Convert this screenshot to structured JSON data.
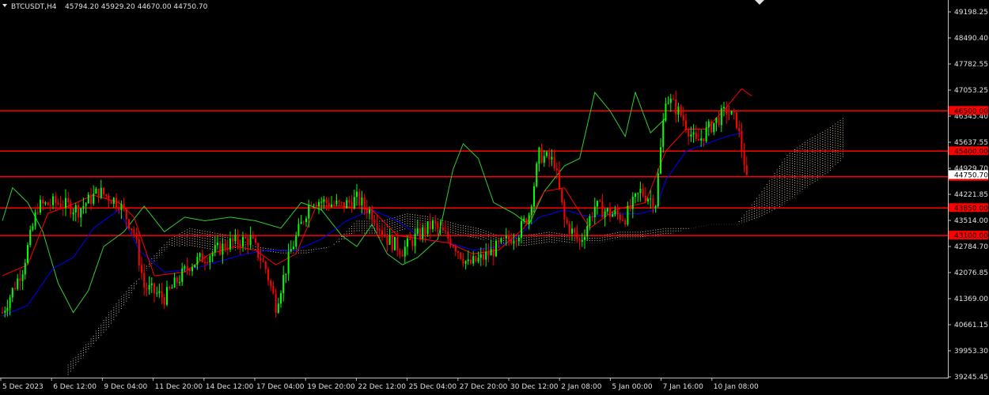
{
  "header": {
    "symbol": "BTCUSDT,H4",
    "ohlc": "45794.20 45929.20 44670.00 44750.70"
  },
  "colors": {
    "background": "#000000",
    "bull": "#00ff00",
    "bear": "#ff0000",
    "tenkan": "#ff0000",
    "kijun": "#0000ff",
    "chikou": "#32cd32",
    "cloud_a": "#ffe4c4",
    "cloud_b": "#e8e8e8",
    "level": "#ff0000",
    "axis": "#c0c0c0"
  },
  "chart_data": {
    "type": "candlestick",
    "ylim": [
      39245.45,
      49400
    ],
    "y_ticks": [
      "49198.25",
      "48490.40",
      "47782.55",
      "47053.25",
      "46345.40",
      "45637.55",
      "44929.70",
      "44221.85",
      "43514.00",
      "42784.70",
      "42076.85",
      "41369.00",
      "40661.15",
      "39953.30",
      "39245.45"
    ],
    "x_ticks": [
      "5 Dec 2023",
      "6 Dec 12:00",
      "9 Dec 04:00",
      "11 Dec 20:00",
      "14 Dec 12:00",
      "17 Dec 04:00",
      "19 Dec 20:00",
      "22 Dec 12:00",
      "25 Dec 04:00",
      "27 Dec 20:00",
      "30 Dec 12:00",
      "2 Jan 08:00",
      "5 Jan 00:00",
      "7 Jan 16:00",
      "10 Jan 08:00"
    ],
    "levels": [
      {
        "value": 46500,
        "label": "46500.00"
      },
      {
        "value": 45400,
        "label": "45400.00"
      },
      {
        "value": 44700,
        "label": "44700.00"
      },
      {
        "value": 43850,
        "label": "43850.00"
      },
      {
        "value": 43100,
        "label": "43100.00"
      }
    ],
    "current_price": {
      "value": 44750.7,
      "label": "44750.70"
    },
    "x_start": "5 Dec 2023 00:00",
    "bar_period_hours": 4,
    "anchors": [
      [
        0,
        41000
      ],
      [
        8,
        42200
      ],
      [
        14,
        43900
      ],
      [
        22,
        44000
      ],
      [
        30,
        43800
      ],
      [
        38,
        44300
      ],
      [
        46,
        44000
      ],
      [
        52,
        43200
      ],
      [
        56,
        41700
      ],
      [
        64,
        41400
      ],
      [
        74,
        42300
      ],
      [
        82,
        42600
      ],
      [
        90,
        42900
      ],
      [
        98,
        43000
      ],
      [
        104,
        42200
      ],
      [
        108,
        41200
      ],
      [
        114,
        42700
      ],
      [
        122,
        44100
      ],
      [
        128,
        44000
      ],
      [
        134,
        43900
      ],
      [
        140,
        44100
      ],
      [
        146,
        43700
      ],
      [
        152,
        43000
      ],
      [
        158,
        42700
      ],
      [
        164,
        43100
      ],
      [
        170,
        43400
      ],
      [
        178,
        42900
      ],
      [
        184,
        42300
      ],
      [
        190,
        42500
      ],
      [
        196,
        42800
      ],
      [
        204,
        43200
      ],
      [
        208,
        43700
      ],
      [
        212,
        45300
      ],
      [
        218,
        45100
      ],
      [
        222,
        43500
      ],
      [
        228,
        42900
      ],
      [
        234,
        43900
      ],
      [
        240,
        43700
      ],
      [
        246,
        43600
      ],
      [
        252,
        44300
      ],
      [
        258,
        44000
      ],
      [
        262,
        46900
      ],
      [
        268,
        46400
      ],
      [
        274,
        45600
      ],
      [
        280,
        46100
      ],
      [
        286,
        46500
      ],
      [
        290,
        46200
      ],
      [
        294,
        44750
      ]
    ],
    "tenkan": [
      [
        0,
        42000
      ],
      [
        10,
        42300
      ],
      [
        18,
        43700
      ],
      [
        26,
        43900
      ],
      [
        36,
        44200
      ],
      [
        46,
        44000
      ],
      [
        52,
        43600
      ],
      [
        60,
        42000
      ],
      [
        72,
        42100
      ],
      [
        82,
        42600
      ],
      [
        92,
        42800
      ],
      [
        100,
        42700
      ],
      [
        108,
        42300
      ],
      [
        116,
        42600
      ],
      [
        124,
        43900
      ],
      [
        134,
        43900
      ],
      [
        146,
        43800
      ],
      [
        156,
        43100
      ],
      [
        166,
        43000
      ],
      [
        176,
        42900
      ],
      [
        186,
        42600
      ],
      [
        196,
        42700
      ],
      [
        206,
        43300
      ],
      [
        214,
        44300
      ],
      [
        222,
        44400
      ],
      [
        232,
        43300
      ],
      [
        242,
        43800
      ],
      [
        254,
        44000
      ],
      [
        262,
        45400
      ],
      [
        270,
        46000
      ],
      [
        278,
        46000
      ],
      [
        286,
        46600
      ],
      [
        292,
        47100
      ],
      [
        296,
        46900
      ]
    ],
    "kijun": [
      [
        0,
        40900
      ],
      [
        10,
        41200
      ],
      [
        20,
        42200
      ],
      [
        28,
        42500
      ],
      [
        36,
        43300
      ],
      [
        46,
        43800
      ],
      [
        54,
        42700
      ],
      [
        64,
        42100
      ],
      [
        76,
        42200
      ],
      [
        86,
        42400
      ],
      [
        96,
        42600
      ],
      [
        106,
        42700
      ],
      [
        116,
        42700
      ],
      [
        126,
        43000
      ],
      [
        136,
        43500
      ],
      [
        146,
        43800
      ],
      [
        156,
        43500
      ],
      [
        166,
        43000
      ],
      [
        176,
        42900
      ],
      [
        186,
        42700
      ],
      [
        196,
        42800
      ],
      [
        204,
        43100
      ],
      [
        212,
        43600
      ],
      [
        222,
        43800
      ],
      [
        232,
        43600
      ],
      [
        242,
        43700
      ],
      [
        252,
        43700
      ],
      [
        258,
        43800
      ],
      [
        262,
        44600
      ],
      [
        270,
        45400
      ],
      [
        278,
        45600
      ],
      [
        286,
        45800
      ],
      [
        292,
        45900
      ]
    ],
    "chikou": [
      [
        0,
        43500
      ],
      [
        4,
        44400
      ],
      [
        10,
        44000
      ],
      [
        16,
        43200
      ],
      [
        22,
        41800
      ],
      [
        28,
        41000
      ],
      [
        34,
        41600
      ],
      [
        40,
        42800
      ],
      [
        48,
        43200
      ],
      [
        56,
        43900
      ],
      [
        64,
        43200
      ],
      [
        72,
        43600
      ],
      [
        80,
        43500
      ],
      [
        90,
        43600
      ],
      [
        100,
        43500
      ],
      [
        110,
        43300
      ],
      [
        118,
        44000
      ],
      [
        126,
        43800
      ],
      [
        134,
        43100
      ],
      [
        140,
        42800
      ],
      [
        146,
        43400
      ],
      [
        152,
        42600
      ],
      [
        158,
        42300
      ],
      [
        164,
        42500
      ],
      [
        172,
        43000
      ],
      [
        178,
        44900
      ],
      [
        182,
        45600
      ],
      [
        188,
        45200
      ],
      [
        194,
        44000
      ],
      [
        202,
        43700
      ],
      [
        208,
        43400
      ],
      [
        214,
        44300
      ],
      [
        222,
        45000
      ],
      [
        228,
        45200
      ],
      [
        234,
        47000
      ],
      [
        240,
        46500
      ],
      [
        246,
        45800
      ],
      [
        250,
        47000
      ],
      [
        256,
        45900
      ],
      [
        262,
        46300
      ]
    ],
    "span_a": [
      [
        26,
        39300
      ],
      [
        34,
        40000
      ],
      [
        42,
        40600
      ],
      [
        50,
        41400
      ],
      [
        58,
        42400
      ],
      [
        66,
        43000
      ],
      [
        74,
        43300
      ],
      [
        82,
        43200
      ],
      [
        90,
        43100
      ],
      [
        100,
        42800
      ],
      [
        110,
        42700
      ],
      [
        120,
        42700
      ],
      [
        130,
        42800
      ],
      [
        140,
        43500
      ],
      [
        150,
        43500
      ],
      [
        160,
        43700
      ],
      [
        170,
        43600
      ],
      [
        180,
        43400
      ],
      [
        188,
        43300
      ],
      [
        196,
        43100
      ],
      [
        206,
        43100
      ],
      [
        216,
        43200
      ],
      [
        226,
        43100
      ],
      [
        236,
        43100
      ],
      [
        244,
        43200
      ],
      [
        252,
        43200
      ],
      [
        262,
        43300
      ],
      [
        272,
        43300
      ],
      [
        280,
        43400
      ],
      [
        290,
        43400
      ],
      [
        300,
        44300
      ],
      [
        310,
        45300
      ],
      [
        318,
        45700
      ],
      [
        326,
        46000
      ],
      [
        332,
        46300
      ]
    ],
    "span_b": [
      [
        26,
        39600
      ],
      [
        34,
        40200
      ],
      [
        42,
        41000
      ],
      [
        50,
        41700
      ],
      [
        58,
        42200
      ],
      [
        66,
        42800
      ],
      [
        74,
        42800
      ],
      [
        82,
        42700
      ],
      [
        90,
        42700
      ],
      [
        100,
        42700
      ],
      [
        110,
        42600
      ],
      [
        120,
        42600
      ],
      [
        130,
        42800
      ],
      [
        140,
        43200
      ],
      [
        150,
        43000
      ],
      [
        160,
        43300
      ],
      [
        170,
        43200
      ],
      [
        180,
        43100
      ],
      [
        188,
        43000
      ],
      [
        196,
        42900
      ],
      [
        206,
        42800
      ],
      [
        216,
        42900
      ],
      [
        226,
        42900
      ],
      [
        236,
        42900
      ],
      [
        244,
        43000
      ],
      [
        252,
        43000
      ],
      [
        262,
        43100
      ],
      [
        272,
        43300
      ],
      [
        280,
        43400
      ],
      [
        290,
        43400
      ],
      [
        300,
        43600
      ],
      [
        310,
        44000
      ],
      [
        318,
        44400
      ],
      [
        326,
        44800
      ],
      [
        332,
        45200
      ]
    ]
  }
}
